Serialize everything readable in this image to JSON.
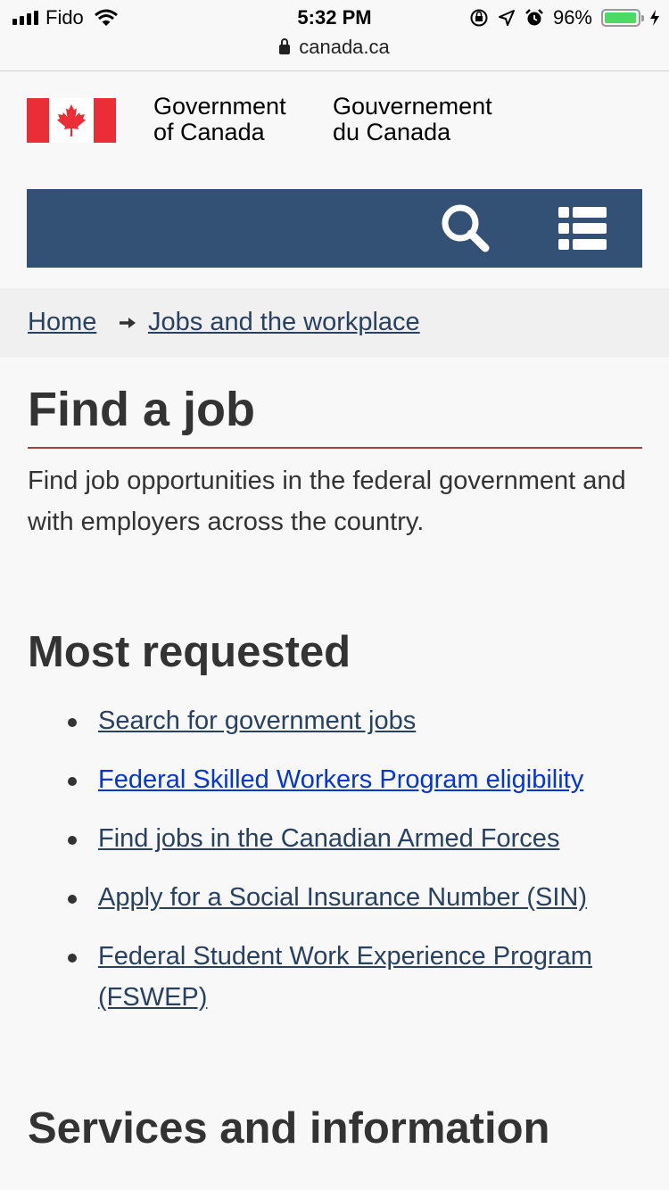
{
  "status_bar": {
    "carrier": "Fido",
    "time": "5:32 PM",
    "battery": "96%",
    "battery_level": 0.96
  },
  "browser": {
    "url": "canada.ca"
  },
  "header": {
    "wordmark_en_line1": "Government",
    "wordmark_en_line2": "of Canada",
    "wordmark_fr_line1": "Gouvernement",
    "wordmark_fr_line2": "du Canada",
    "flag_color": "#eb2d37",
    "menu_bar_color": "#335075",
    "search_icon": "search-icon",
    "menu_icon": "list-menu-icon"
  },
  "breadcrumb": {
    "items": [
      {
        "label": "Home"
      },
      {
        "label": "Jobs and the workplace"
      }
    ]
  },
  "main": {
    "title": "Find a job",
    "intro": "Find job opportunities in the federal government and with employers across the country.",
    "most_requested": {
      "heading": "Most requested",
      "links": [
        {
          "label": "Search for government jobs"
        },
        {
          "label": "Federal Skilled Workers Program eligibility"
        },
        {
          "label": "Find jobs in the Canadian Armed Forces"
        },
        {
          "label": "Apply for a Social Insurance Number (SIN)"
        },
        {
          "label": "Federal Student Work Experience Program (FSWEP)"
        }
      ]
    },
    "services_heading": "Services and information"
  },
  "colors": {
    "link": "#284162",
    "link_active": "#0535d2",
    "title_rule": "#af3c43",
    "text": "#333333"
  }
}
